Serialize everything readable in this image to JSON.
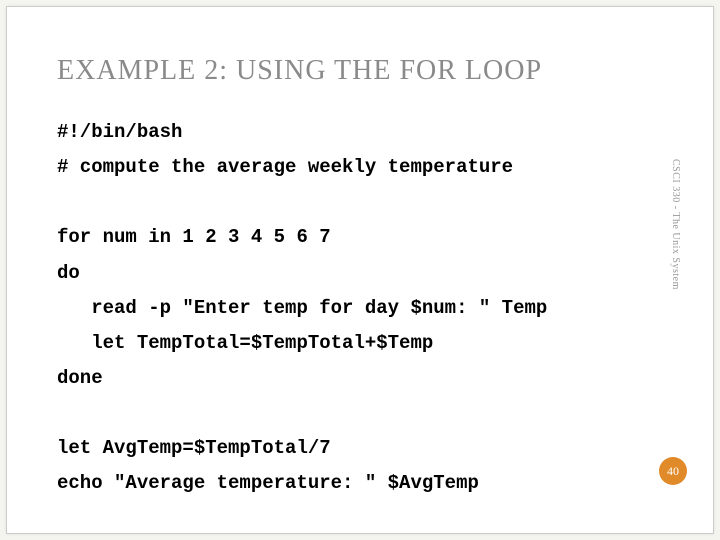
{
  "slide": {
    "title": "EXAMPLE 2: USING THE FOR LOOP",
    "code": "#!/bin/bash\n# compute the average weekly temperature\n\nfor num in 1 2 3 4 5 6 7\ndo\n   read -p \"Enter temp for day $num: \" Temp\n   let TempTotal=$TempTotal+$Temp\ndone\n\nlet AvgTemp=$TempTotal/7\necho \"Average temperature: \" $AvgTemp",
    "side_label": "CSCI 330 - The Unix System",
    "page_number": "40"
  }
}
